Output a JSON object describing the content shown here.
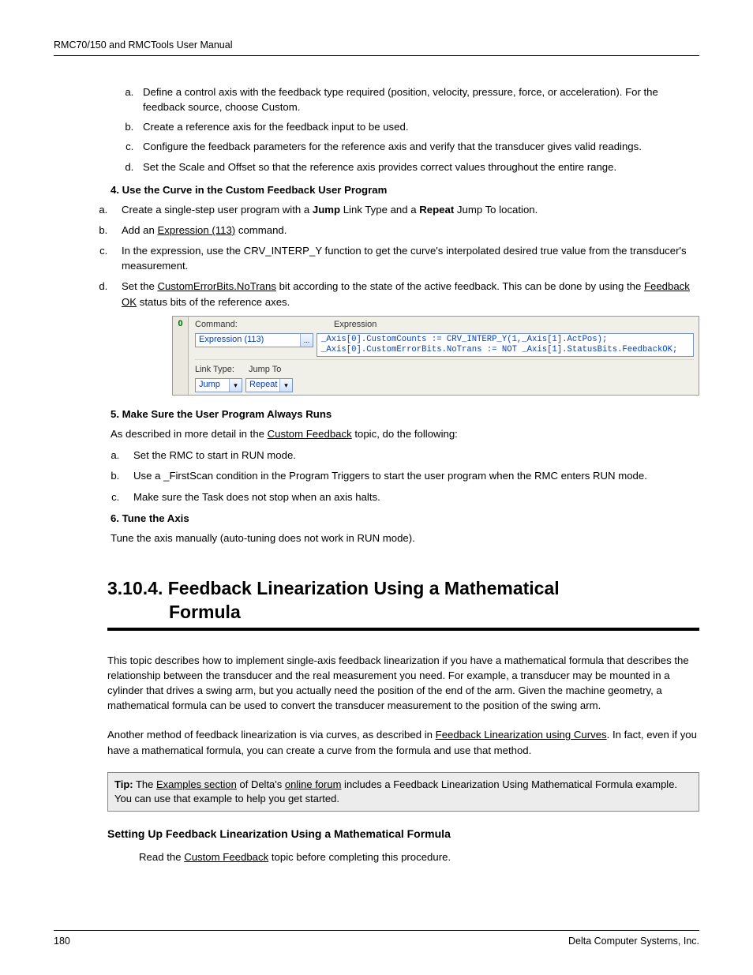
{
  "header": {
    "title": "RMC70/150 and RMCTools User Manual"
  },
  "steps": {
    "list1": [
      "Define a control axis with the feedback type required (position, velocity, pressure, force, or acceleration). For the feedback source, choose Custom.",
      "Create a reference axis for the feedback input to be used.",
      "Configure the feedback parameters for the reference axis and verify that the transducer gives valid readings.",
      "Set the Scale and Offset so that the reference axis provides correct values throughout the entire range."
    ],
    "h4": "4. Use the Curve in the Custom Feedback User Program",
    "l4a_1": "Create a single-step user program with a ",
    "l4a_b1": "Jump",
    "l4a_2": " Link Type and a ",
    "l4a_b2": "Repeat",
    "l4a_3": " Jump To location.",
    "l4b_1": "Add an ",
    "l4b_u": "Expression (113)",
    "l4b_2": " command.",
    "l4c": "In the expression, use the CRV_INTERP_Y function to get the curve's interpolated desired true value from the transducer's measurement.",
    "l4d_1": "Set the ",
    "l4d_u1": "CustomErrorBits.NoTrans",
    "l4d_2": " bit according to the state of the active feedback. This can be done by using the ",
    "l4d_u2": "Feedback OK",
    "l4d_3": " status bits of the reference axes.",
    "h5": "5. Make Sure the User Program Always Runs",
    "l5intro_1": "As described in more detail in the ",
    "l5intro_u": "Custom Feedback",
    "l5intro_2": " topic, do the following:",
    "l5": [
      "Set the RMC to start in RUN mode.",
      "Use a _FirstScan condition in the Program Triggers to start the user program when the RMC enters RUN mode.",
      "Make sure the Task does not stop when an axis halts."
    ],
    "h6": "6. Tune the Axis",
    "l6": "Tune the axis manually (auto-tuning does not work in RUN mode)."
  },
  "fig": {
    "step": "0",
    "lblCommand": "Command:",
    "lblExpression": "Expression",
    "cmdValue": "Expression (113)",
    "ellipsis": "...",
    "exprLine1": "_Axis[0].CustomCounts := CRV_INTERP_Y(1,_Axis[1].ActPos);",
    "exprLine2": "_Axis[0].CustomErrorBits.NoTrans := NOT _Axis[1].StatusBits.FeedbackOK;",
    "lblLinkType": "Link Type:",
    "lblJumpTo": "Jump To",
    "linkType": "Jump",
    "jumpTo": "Repeat",
    "arrow": "▾"
  },
  "section": {
    "num_title_line1": "3.10.4. Feedback Linearization Using a Mathematical",
    "num_title_line2": "Formula",
    "para1": "This topic describes how to implement single-axis feedback linearization if you have a mathematical formula that describes the relationship between the transducer and the real measurement you need. For example, a transducer may be mounted in a cylinder that drives a swing arm, but you actually need the position of the end of the arm. Given the machine geometry, a mathematical formula can be used to convert the transducer measurement to the position of the swing arm.",
    "para2_1": "Another method of feedback linearization is via curves, as described in ",
    "para2_u": "Feedback Linearization using Curves",
    "para2_2": ". In fact, even if you have a mathematical formula, you can create a curve from the formula and use that method.",
    "tip_b": "Tip:",
    "tip_1": " The ",
    "tip_u1": "Examples section",
    "tip_2": " of Delta's ",
    "tip_u2": "online forum",
    "tip_3": " includes a Feedback Linearization Using Mathematical Formula example. You can use that example to help you get started.",
    "sub": "Setting Up Feedback Linearization Using a Mathematical Formula",
    "read_1": "Read the ",
    "read_u": "Custom Feedback",
    "read_2": " topic before completing this procedure."
  },
  "footer": {
    "page": "180",
    "company": "Delta Computer Systems, Inc."
  }
}
